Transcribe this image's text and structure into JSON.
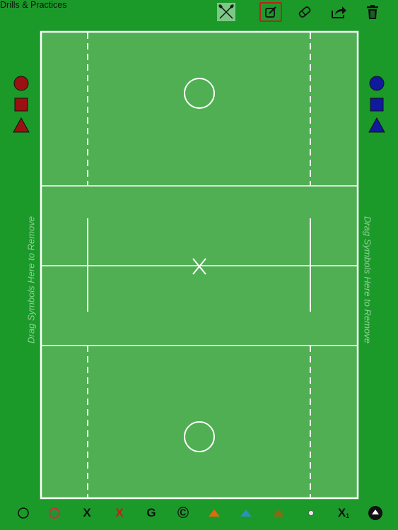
{
  "header": {
    "title": "Drills & Practices"
  },
  "toolbar": {
    "items": [
      {
        "icon": "crossed-sticks-icon",
        "active": true
      },
      {
        "icon": "edit-icon",
        "selected": true
      },
      {
        "icon": "eraser-icon"
      },
      {
        "icon": "share-icon"
      },
      {
        "icon": "trash-icon"
      }
    ]
  },
  "sidebars": {
    "remove_hint": "Drag Symbols Here to Remove",
    "left_team_color": "#9b1111",
    "right_team_color": "#0f1a9e"
  },
  "bottom_palette": {
    "x_label": "X",
    "g_label": "G",
    "c_label": "©",
    "x1_label": "X",
    "x1_subscript": "1",
    "cone_colors": [
      "#e06a10",
      "#2e8fb8",
      "#8a6a10"
    ]
  }
}
